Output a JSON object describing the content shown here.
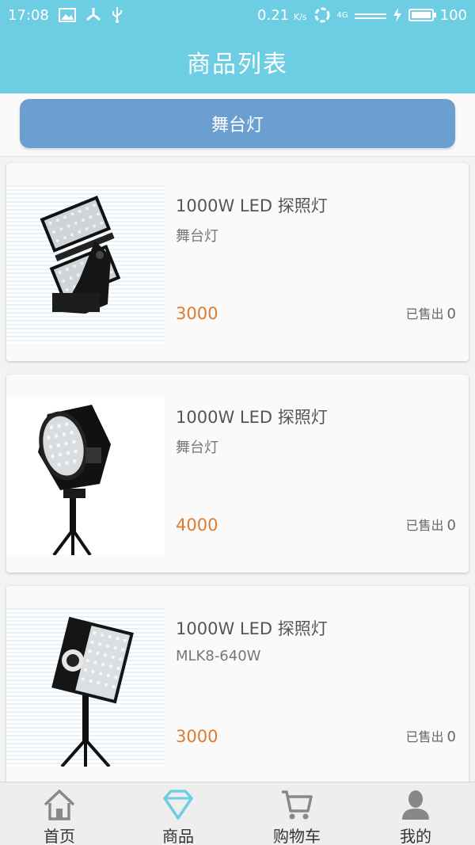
{
  "status_bar": {
    "time": "17:08",
    "speed": "0.21",
    "speed_unit": "K/s",
    "network": "4G",
    "battery": "100",
    "battery_level": 1.0
  },
  "header": {
    "title": "商品列表"
  },
  "category": {
    "label": "舞台灯"
  },
  "products": [
    {
      "name": "1000W LED 探照灯",
      "subtitle": "舞台灯",
      "price": "3000",
      "sold_label": "已售出",
      "sold_count": "0",
      "image": "floodlight-double-panel"
    },
    {
      "name": "1000W LED 探照灯",
      "subtitle": "舞台灯",
      "price": "4000",
      "sold_label": "已售出",
      "sold_count": "0",
      "image": "round-searchlight-tripod"
    },
    {
      "name": "1000W LED 探照灯",
      "subtitle": "MLK8-640W",
      "price": "3000",
      "sold_label": "已售出",
      "sold_count": "0",
      "image": "panel-light-tripod"
    }
  ],
  "tabbar": {
    "active_color": "#6dcde3",
    "items": [
      {
        "label": "首页",
        "icon": "home-icon"
      },
      {
        "label": "商品",
        "icon": "diamond-icon"
      },
      {
        "label": "购物车",
        "icon": "cart-icon"
      },
      {
        "label": "我的",
        "icon": "person-icon"
      }
    ]
  }
}
